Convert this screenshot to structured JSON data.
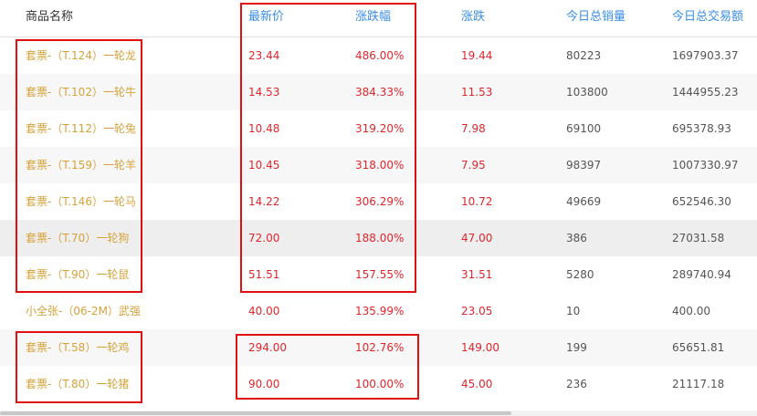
{
  "columns": [
    "商品名称",
    "最新价",
    "涨跌幅",
    "涨跌",
    "今日总销量",
    "今日总交易额"
  ],
  "rows": [
    {
      "name": "套票-（T.124）一轮龙",
      "price": "23.44",
      "pct": "486.00%",
      "change": "19.44",
      "volume": "80223",
      "turnover": "1697903.37"
    },
    {
      "name": "套票-（T.102）一轮牛",
      "price": "14.53",
      "pct": "384.33%",
      "change": "11.53",
      "volume": "103800",
      "turnover": "1444955.23"
    },
    {
      "name": "套票-（T.112）一轮兔",
      "price": "10.48",
      "pct": "319.20%",
      "change": "7.98",
      "volume": "69100",
      "turnover": "695378.93"
    },
    {
      "name": "套票-（T.159）一轮羊",
      "price": "10.45",
      "pct": "318.00%",
      "change": "7.95",
      "volume": "98397",
      "turnover": "1007330.97"
    },
    {
      "name": "套票-（T.146）一轮马",
      "price": "14.22",
      "pct": "306.29%",
      "change": "10.72",
      "volume": "49669",
      "turnover": "652546.30"
    },
    {
      "name": "套票-（T.70）一轮狗",
      "price": "72.00",
      "pct": "188.00%",
      "change": "47.00",
      "volume": "386",
      "turnover": "27031.58"
    },
    {
      "name": "套票-（T.90）一轮鼠",
      "price": "51.51",
      "pct": "157.55%",
      "change": "31.51",
      "volume": "5280",
      "turnover": "289740.94"
    },
    {
      "name": "小全张-（06-2M）武强",
      "price": "40.00",
      "pct": "135.99%",
      "change": "23.05",
      "volume": "10",
      "turnover": "400.00"
    },
    {
      "name": "套票-（T.58）一轮鸡",
      "price": "294.00",
      "pct": "102.76%",
      "change": "149.00",
      "volume": "199",
      "turnover": "65651.81"
    },
    {
      "name": "套票-（T.80）一轮猪",
      "price": "90.00",
      "pct": "100.00%",
      "change": "45.00",
      "volume": "236",
      "turnover": "21117.18"
    }
  ],
  "colors": {
    "accent_blue": "#3a8ee6",
    "price_red": "#e0262d",
    "name_gold": "#d8a23a",
    "highlight_box": "#e01010"
  }
}
